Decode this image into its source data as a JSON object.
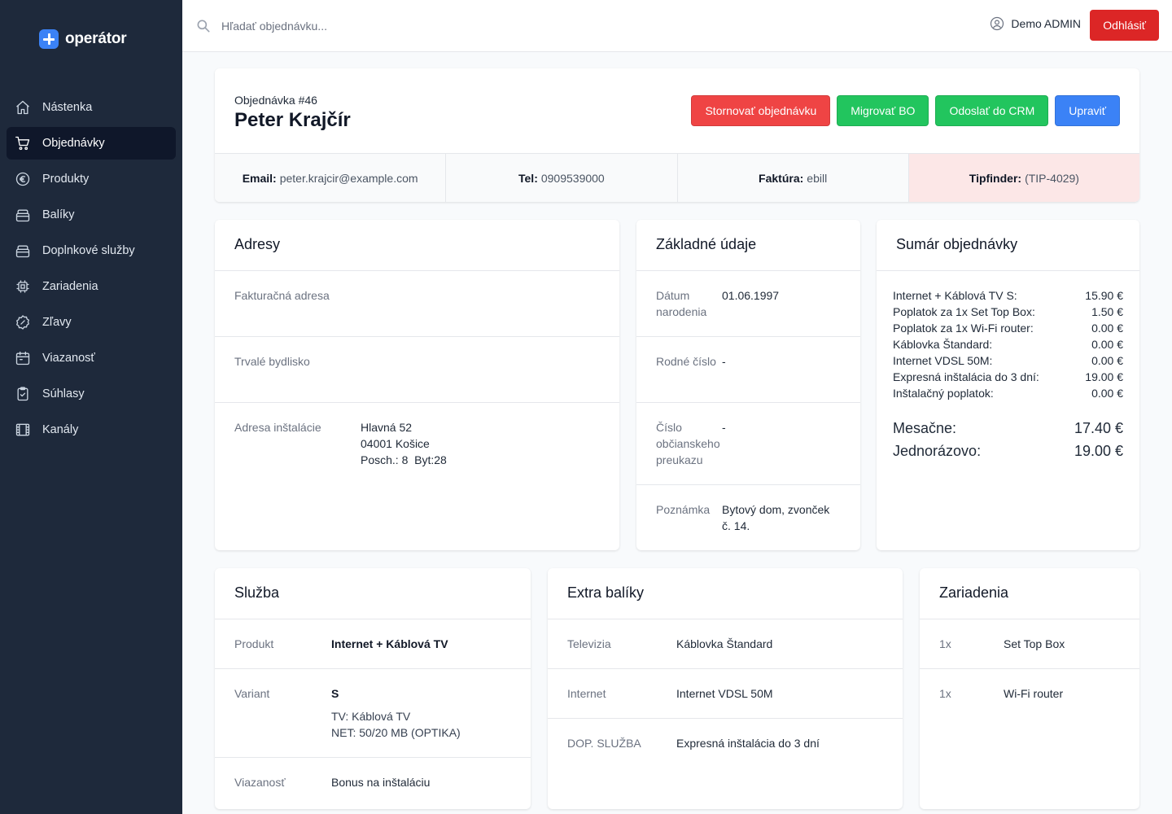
{
  "app": {
    "logo_text": "operátor"
  },
  "sidebar": {
    "items": [
      {
        "label": "Nástenka",
        "icon": "home-icon"
      },
      {
        "label": "Objednávky",
        "icon": "cart-icon",
        "active": true
      },
      {
        "label": "Produkty",
        "icon": "euro-icon"
      },
      {
        "label": "Balíky",
        "icon": "package-icon"
      },
      {
        "label": "Doplnkové služby",
        "icon": "package-icon"
      },
      {
        "label": "Zariadenia",
        "icon": "chip-icon"
      },
      {
        "label": "Zľavy",
        "icon": "discount-icon"
      },
      {
        "label": "Viazanosť",
        "icon": "calendar-icon"
      },
      {
        "label": "Súhlasy",
        "icon": "clipboard-check-icon"
      },
      {
        "label": "Kanály",
        "icon": "film-icon"
      }
    ]
  },
  "topbar": {
    "search_placeholder": "Hľadať objednávku...",
    "user_name": "Demo ADMIN",
    "logout_label": "Odhlásiť"
  },
  "order": {
    "number_label": "Objednávka #46",
    "customer_name": "Peter Krajčír",
    "actions": {
      "cancel": "Stornovať objednávku",
      "migrate": "Migrovať BO",
      "send_crm": "Odoslať do CRM",
      "edit": "Upraviť"
    },
    "info": {
      "email_label": "Email:",
      "email": "peter.krajcir@example.com",
      "tel_label": "Tel:",
      "tel": "0909539000",
      "invoice_label": "Faktúra:",
      "invoice": "ebill",
      "tipfinder_label": "Tipfinder:",
      "tipfinder": "(TIP-4029)"
    }
  },
  "addresses": {
    "title": "Adresy",
    "billing_label": "Fakturačná adresa",
    "permanent_label": "Trvalé bydlisko",
    "install_label": "Adresa inštalácie",
    "install_line1": "Hlavná 52",
    "install_line2": "04001 Košice",
    "install_line3": "Posch.: 8  Byt:28"
  },
  "basic": {
    "title": "Základné údaje",
    "rows": [
      {
        "label": "Dátum narodenia",
        "value": "01.06.1997"
      },
      {
        "label": "Rodné číslo",
        "value": "-"
      },
      {
        "label": "Číslo občianskeho preukazu",
        "value": "-"
      },
      {
        "label": "Poznámka",
        "value": "Bytový dom, zvonček č. 14."
      }
    ]
  },
  "summary": {
    "title": "Sumár objednávky",
    "lines": [
      {
        "label": "Internet + Káblová TV S:",
        "value": "15.90 €"
      },
      {
        "label": "Poplatok za 1x Set Top Box:",
        "value": "1.50 €"
      },
      {
        "label": "Poplatok za 1x Wi-Fi router:",
        "value": "0.00 €"
      },
      {
        "label": "Káblovka Štandard:",
        "value": "0.00 €"
      },
      {
        "label": "Internet VDSL 50M:",
        "value": "0.00 €"
      },
      {
        "label": "Expresná inštalácia do 3 dní:",
        "value": "19.00 €"
      },
      {
        "label": "Inštalačný poplatok:",
        "value": "0.00 €"
      }
    ],
    "monthly_label": "Mesačne:",
    "monthly_value": "17.40 €",
    "onetime_label": "Jednorázovo:",
    "onetime_value": "19.00 €"
  },
  "service": {
    "title": "Služba",
    "product_label": "Produkt",
    "product_value": "Internet + Káblová TV",
    "variant_label": "Variant",
    "variant_value": "S",
    "variant_tv": "TV: Káblová TV",
    "variant_net": "NET: 50/20 MB (OPTIKA)",
    "commitment_label": "Viazanosť",
    "commitment_value": "Bonus na inštaláciu"
  },
  "extra": {
    "title": "Extra balíky",
    "rows": [
      {
        "label": "Televizia",
        "value": "Káblovka Štandard"
      },
      {
        "label": "Internet",
        "value": "Internet VDSL 50M"
      },
      {
        "label": "DOP. SLUŽBA",
        "value": "Expresná inštalácia do 3 dní"
      }
    ]
  },
  "devices": {
    "title": "Zariadenia",
    "rows": [
      {
        "qty": "1x",
        "name": "Set Top Box"
      },
      {
        "qty": "1x",
        "name": "Wi-Fi router"
      }
    ]
  }
}
